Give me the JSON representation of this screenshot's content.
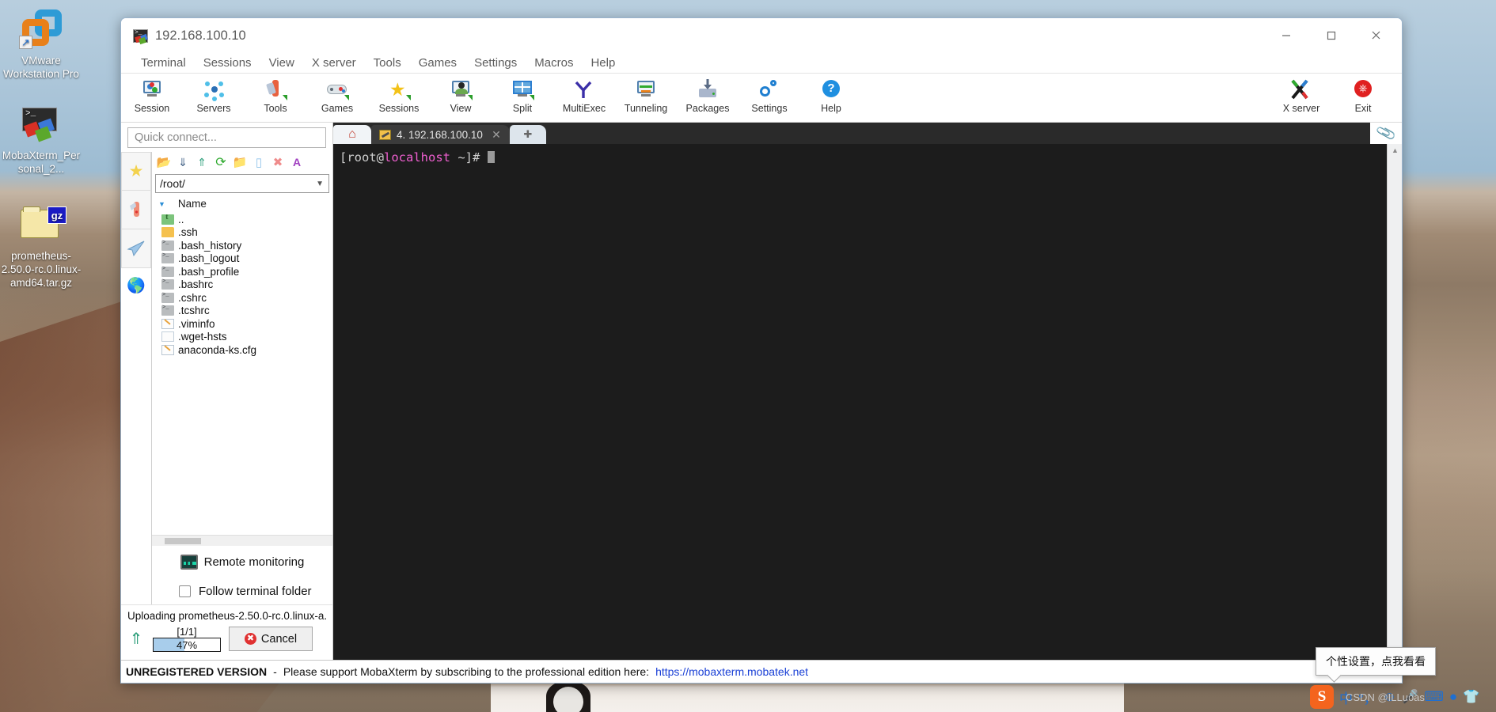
{
  "desktop": {
    "icons": [
      {
        "name": "vmware-workstation-pro",
        "label": "VMware Workstation Pro"
      },
      {
        "name": "mobaxterm-personal",
        "label": "MobaXterm_Personal_2..."
      },
      {
        "name": "prometheus-archive",
        "label": "prometheus-2.50.0-rc.0.linux-amd64.tar.gz",
        "badge": "gz"
      }
    ]
  },
  "window": {
    "title": "192.168.100.10",
    "controls": {
      "minimize": "—",
      "maximize": "☐",
      "close": "✕"
    }
  },
  "menubar": {
    "items": [
      "Terminal",
      "Sessions",
      "View",
      "X server",
      "Tools",
      "Games",
      "Settings",
      "Macros",
      "Help"
    ]
  },
  "toolbar": {
    "buttons": [
      {
        "name": "session",
        "label": "Session",
        "icon": "session-icon"
      },
      {
        "name": "servers",
        "label": "Servers",
        "icon": "servers-icon"
      },
      {
        "name": "tools",
        "label": "Tools",
        "icon": "tools-icon"
      },
      {
        "name": "games",
        "label": "Games",
        "icon": "gamepad-icon"
      },
      {
        "name": "sessions",
        "label": "Sessions",
        "icon": "star-icon"
      },
      {
        "name": "view",
        "label": "View",
        "icon": "view-icon"
      },
      {
        "name": "split",
        "label": "Split",
        "icon": "split-icon"
      },
      {
        "name": "multiexec",
        "label": "MultiExec",
        "icon": "multiexec-icon"
      },
      {
        "name": "tunneling",
        "label": "Tunneling",
        "icon": "tunneling-icon"
      },
      {
        "name": "packages",
        "label": "Packages",
        "icon": "package-icon"
      },
      {
        "name": "settings",
        "label": "Settings",
        "icon": "gear-icon"
      },
      {
        "name": "help",
        "label": "Help",
        "icon": "question-icon"
      }
    ],
    "right_buttons": [
      {
        "name": "x-server",
        "label": "X server",
        "icon": "x-server-icon"
      },
      {
        "name": "exit",
        "label": "Exit",
        "icon": "power-icon"
      }
    ]
  },
  "sidebar": {
    "quick_connect_placeholder": "Quick connect...",
    "vertical_tabs": [
      {
        "name": "sessions-tab",
        "icon": "star-icon",
        "glyph": "★"
      },
      {
        "name": "tools-tab",
        "icon": "swiss-knife-icon",
        "glyph": "⚔"
      },
      {
        "name": "sftp-tab",
        "icon": "paper-plane-icon",
        "glyph": "➤"
      },
      {
        "name": "macros-tab",
        "icon": "globe-icon",
        "glyph": "🌐"
      }
    ],
    "browser_toolbar": [
      {
        "name": "parent-folder-button",
        "icon": "folder-up-icon",
        "glyph": "↰"
      },
      {
        "name": "download-button",
        "icon": "download-icon",
        "glyph": "⤓"
      },
      {
        "name": "upload-button",
        "icon": "upload-icon",
        "glyph": "⤒"
      },
      {
        "name": "refresh-button",
        "icon": "refresh-icon",
        "glyph": "⟳"
      },
      {
        "name": "new-folder-button",
        "icon": "new-folder-icon",
        "glyph": "⊞"
      },
      {
        "name": "new-file-button",
        "icon": "new-file-icon",
        "glyph": "▯"
      },
      {
        "name": "delete-button",
        "icon": "delete-icon",
        "glyph": "✖"
      },
      {
        "name": "text-mode-button",
        "icon": "font-icon",
        "glyph": "A"
      }
    ],
    "path": "/root/",
    "column_header": "Name",
    "files": [
      {
        "name": "..",
        "icon": "parent-dir-icon"
      },
      {
        "name": ".ssh",
        "icon": "folder-icon"
      },
      {
        "name": ".bash_history",
        "icon": "shell-file-icon"
      },
      {
        "name": ".bash_logout",
        "icon": "shell-file-icon"
      },
      {
        "name": ".bash_profile",
        "icon": "shell-file-icon"
      },
      {
        "name": ".bashrc",
        "icon": "shell-file-icon"
      },
      {
        "name": ".cshrc",
        "icon": "shell-file-icon"
      },
      {
        "name": ".tcshrc",
        "icon": "shell-file-icon"
      },
      {
        "name": ".viminfo",
        "icon": "text-file-icon"
      },
      {
        "name": ".wget-hsts",
        "icon": "blank-file-icon"
      },
      {
        "name": "anaconda-ks.cfg",
        "icon": "text-file-icon"
      }
    ],
    "remote_monitoring_label": "Remote monitoring",
    "follow_terminal_folder_label": "Follow terminal folder",
    "follow_terminal_folder_checked": false,
    "upload": {
      "status": "Uploading prometheus-2.50.0-rc.0.linux-a...",
      "count": "[1/1]",
      "percent_label": "47%",
      "percent_value": 47,
      "cancel_label": "Cancel"
    }
  },
  "tabs": {
    "home_label": "⌂",
    "active": {
      "label": "4. 192.168.100.10",
      "close": "✕"
    },
    "new_tab_label": "✚",
    "clip_icon": "paperclip-icon"
  },
  "terminal": {
    "prompt_open": "[root@",
    "prompt_host": "localhost",
    "prompt_close": " ~]# "
  },
  "footer": {
    "unregistered": "UNREGISTERED VERSION",
    "dash": "-",
    "message": "Please support MobaXterm by subscribing to the professional edition here:",
    "link": "https://mobaxterm.mobatek.net"
  },
  "tooltip": {
    "text": "个性设置，点我看看"
  },
  "taskbar": {
    "ime": {
      "logo": "S",
      "mode": "中",
      "punct": "°，",
      "emoji": "☺",
      "voice": "🎤",
      "keyboard": "⌨",
      "user": "●",
      "skin": "👕"
    },
    "watermark": "CSDN @ILLuoas"
  },
  "colors": {
    "accent": "#1f7fd0",
    "terminal_bg": "#1c1c1c",
    "prompt_host": "#ef5fd0",
    "progress_fill": "#a8cdeb",
    "link": "#1a40d6",
    "danger": "#e03131"
  }
}
